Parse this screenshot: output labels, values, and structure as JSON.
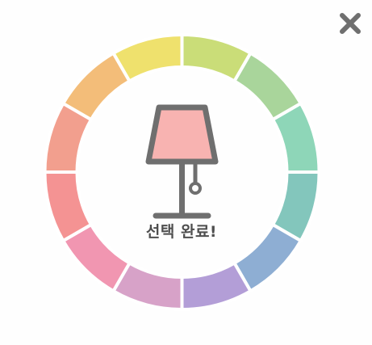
{
  "dialog": {
    "done_label": "선택 완료!",
    "close_icon": "close-icon",
    "center_icon": "lamp-icon"
  },
  "palette": {
    "swatches": [
      {
        "name": "yellow-green",
        "color": "#cadd78"
      },
      {
        "name": "light-green",
        "color": "#a9d59b"
      },
      {
        "name": "mint",
        "color": "#8ed6b8"
      },
      {
        "name": "teal",
        "color": "#83c6bc"
      },
      {
        "name": "blue",
        "color": "#8eaed3"
      },
      {
        "name": "lavender",
        "color": "#b39ed7"
      },
      {
        "name": "mauve",
        "color": "#d7a2c8"
      },
      {
        "name": "pink",
        "color": "#f196b1"
      },
      {
        "name": "salmon",
        "color": "#f49393"
      },
      {
        "name": "coral",
        "color": "#f29f8e"
      },
      {
        "name": "orange",
        "color": "#f3bd79"
      },
      {
        "name": "yellow",
        "color": "#efe16d"
      }
    ],
    "lamp_shade_color": "#f8b3b1",
    "lamp_frame_color": "#6f6f6f",
    "close_color": "#6f6f6f"
  }
}
